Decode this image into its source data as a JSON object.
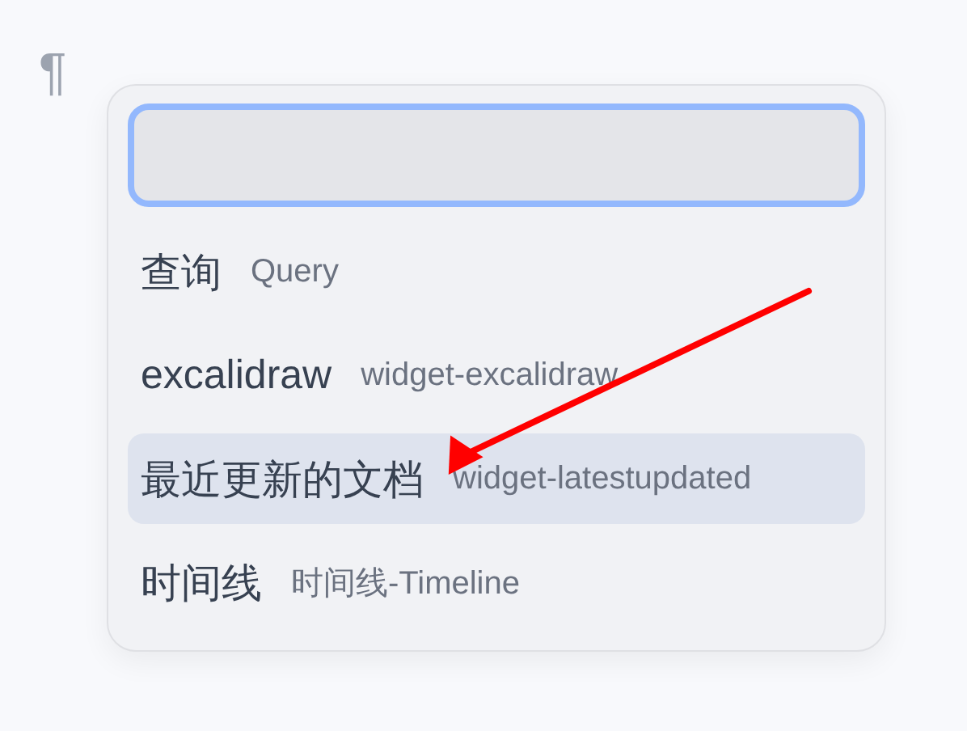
{
  "paragraph_mark": "¶",
  "search_field": {
    "focused": true
  },
  "items": [
    {
      "title": "查询",
      "subtitle": "Query",
      "selected": false
    },
    {
      "title": "excalidraw",
      "subtitle": "widget-excalidraw",
      "selected": false
    },
    {
      "title": "最近更新的文档",
      "subtitle": "widget-latestupdated",
      "selected": true
    },
    {
      "title": "时间线",
      "subtitle": "时间线-Timeline",
      "selected": false
    }
  ],
  "annotation": {
    "kind": "arrow"
  }
}
